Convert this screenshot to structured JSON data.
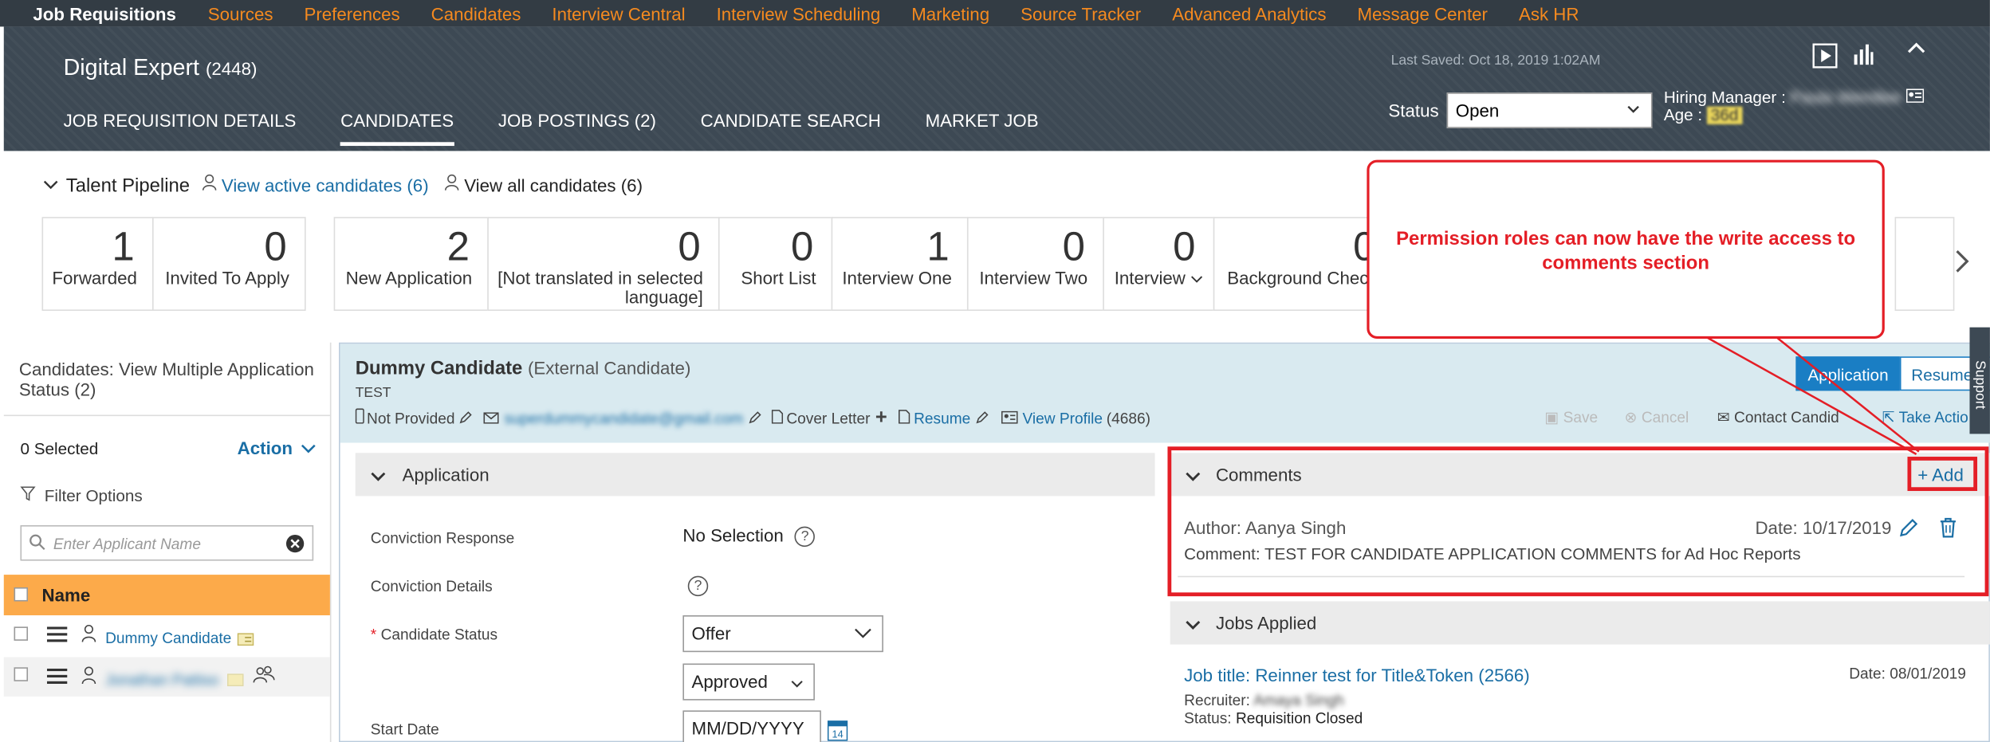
{
  "topnav": {
    "brand": "Job Requisitions",
    "links": [
      "Sources",
      "Preferences",
      "Candidates",
      "Interview Central",
      "Interview Scheduling",
      "Marketing",
      "Source Tracker",
      "Advanced Analytics",
      "Message Center",
      "Ask HR"
    ]
  },
  "header": {
    "title": "Digital Expert",
    "req_count": "(2448)",
    "last_saved": "Last Saved: Oct 18, 2019 1:02AM",
    "tabs": [
      "JOB REQUISITION DETAILS",
      "CANDIDATES",
      "JOB POSTINGS (2)",
      "CANDIDATE SEARCH",
      "MARKET JOB"
    ],
    "status_label": "Status",
    "status_value": "Open",
    "hiring_manager_label": "Hiring Manager :",
    "hiring_manager_value": "Paula Wemllee",
    "age_label": "Age :",
    "age_value": "36d"
  },
  "pipeline": {
    "title": "Talent Pipeline",
    "view_active": "View active candidates (6)",
    "view_all": "View all candidates (6)",
    "stages": [
      {
        "count": "1",
        "label": "Forwarded"
      },
      {
        "count": "0",
        "label": "Invited To Apply"
      },
      {
        "count": "2",
        "label": "New Application"
      },
      {
        "count": "0",
        "label": "[Not translated in selected language]"
      },
      {
        "count": "0",
        "label": "Short List"
      },
      {
        "count": "1",
        "label": "Interview One"
      },
      {
        "count": "0",
        "label": "Interview Two"
      },
      {
        "count": "0",
        "label": "Interview"
      },
      {
        "count": "0",
        "label": "Background Chec"
      }
    ]
  },
  "callout": {
    "text": "Permission roles can now have the write access to comments section"
  },
  "left_panel": {
    "title": "Candidates: View Multiple Application Status (2)",
    "selected": "0 Selected",
    "action": "Action",
    "filter_options": "Filter Options",
    "search_placeholder": "Enter Applicant Name",
    "name_header": "Name",
    "rows": [
      {
        "name": "Dummy Candidate"
      },
      {
        "name": "Jonathan Pattiso"
      }
    ]
  },
  "candidate": {
    "name": "Dummy Candidate",
    "type": "(External Candidate)",
    "subtitle": "TEST",
    "phone": "Not Provided",
    "email": "superdummycandidate@gmail.com",
    "cover_letter": "Cover Letter",
    "resume": "Resume",
    "view_profile": "View Profile",
    "profile_count": "(4686)",
    "toggle_application": "Application",
    "toggle_resume": "Resume",
    "save": "Save",
    "cancel": "Cancel",
    "contact": "Contact Candid",
    "take_action": "Take Actio"
  },
  "application": {
    "title": "Application",
    "conviction_response_label": "Conviction Response",
    "conviction_response_value": "No Selection",
    "conviction_details_label": "Conviction Details",
    "candidate_status_label": "Candidate Status",
    "required_mark": "*",
    "status_value": "Offer",
    "substatus_value": "Approved",
    "start_date_label": "Start Date",
    "start_date_placeholder": "MM/DD/YYYY",
    "calendar_day": "14"
  },
  "comments": {
    "title": "Comments",
    "add": "+ Add",
    "author": "Author: Aanya Singh",
    "date": "Date: 10/17/2019",
    "comment": "Comment: TEST FOR CANDIDATE APPLICATION COMMENTS for Ad Hoc Reports"
  },
  "jobs_applied": {
    "title": "Jobs Applied",
    "job_title": "Job title: Reinner test for Title&Token (2566)",
    "date": "Date: 08/01/2019",
    "recruiter_label": "Recruiter:",
    "recruiter_value": "Amaya Singh",
    "status_label": "Status:",
    "status_value": "Requisition Closed"
  },
  "support_tab": "Support",
  "colors": {
    "accent_orange": "#f58a1f",
    "header_bg": "#3d4954",
    "link_blue": "#1a6ea5",
    "highlight_red": "#e41e26",
    "name_header": "#fcaa4a"
  }
}
